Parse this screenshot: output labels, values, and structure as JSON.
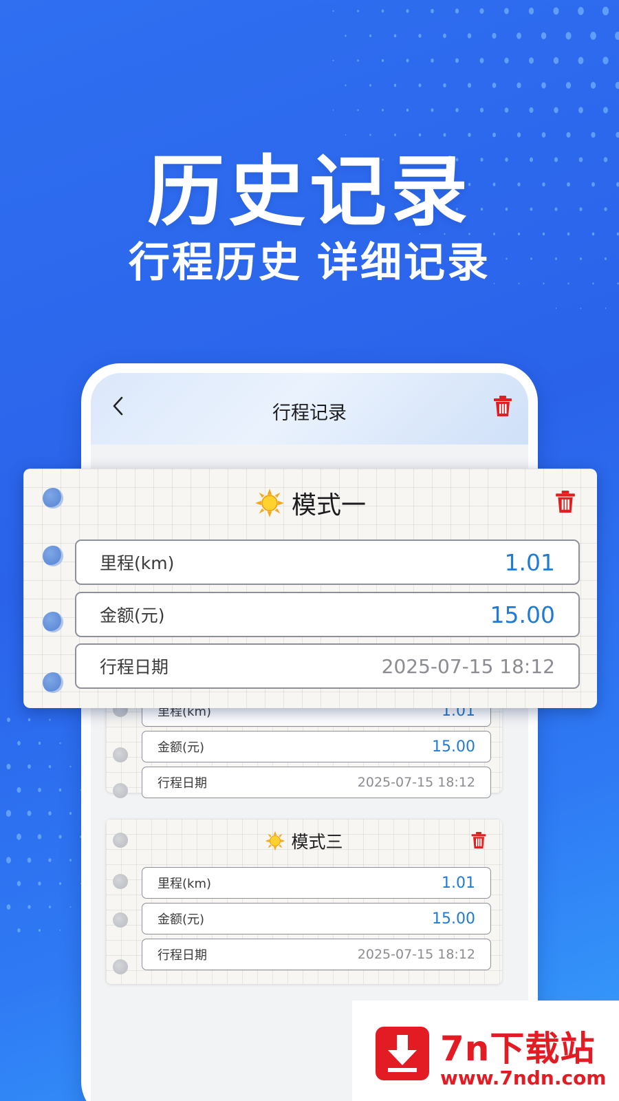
{
  "promo": {
    "title": "历史记录",
    "subtitle_left": "行程历史",
    "subtitle_right": "详细记录"
  },
  "app": {
    "header_title": "行程记录",
    "icons": {
      "back": "chevron-left-icon",
      "delete": "trash-icon",
      "mode": "sun-icon"
    },
    "colors": {
      "delete": "#e02020",
      "value": "#1f7bd6",
      "bg": "#2f6ff0"
    }
  },
  "featured_record": {
    "mode": "模式一",
    "rows": [
      {
        "label": "里程(km)",
        "value": "1.01"
      },
      {
        "label": "金额(元)",
        "value": "15.00"
      },
      {
        "label": "行程日期",
        "value": "2025-07-15 18:12"
      }
    ]
  },
  "records": [
    {
      "mode": "",
      "rows": [
        {
          "label": "里程(km)",
          "value": "1.01"
        },
        {
          "label": "金额(元)",
          "value": "15.00"
        },
        {
          "label": "行程日期",
          "value": "2025-07-15 18:12"
        }
      ]
    },
    {
      "mode": "模式三",
      "rows": [
        {
          "label": "里程(km)",
          "value": "1.01"
        },
        {
          "label": "金额(元)",
          "value": "15.00"
        },
        {
          "label": "行程日期",
          "value": "2025-07-15 18:12"
        }
      ]
    }
  ],
  "watermark": {
    "name": "7n下载站",
    "url": "www.7ndn.com",
    "icon": "download-arrow-icon"
  }
}
